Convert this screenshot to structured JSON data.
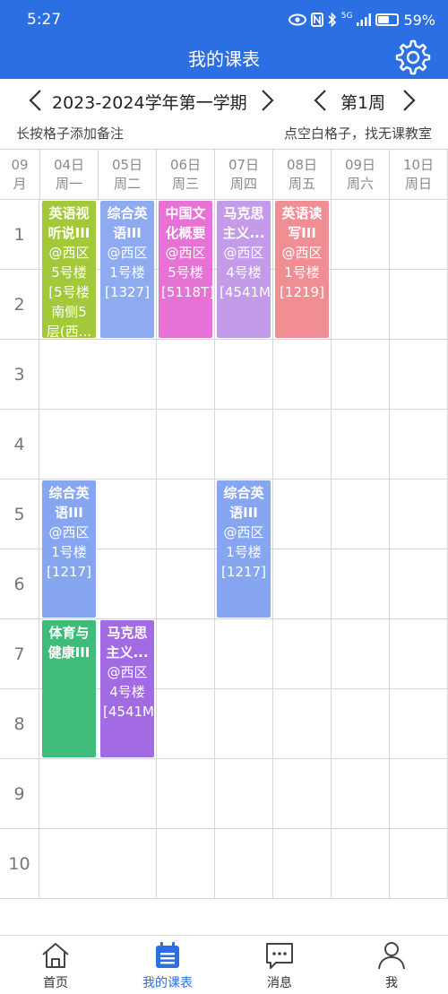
{
  "status_bar": {
    "time": "5:27",
    "network": "5G",
    "battery": "59%"
  },
  "header": {
    "title": "我的课表"
  },
  "nav": {
    "term": "2023-2024学年第一学期",
    "week": "第1周"
  },
  "hints": {
    "left": "长按格子添加备注",
    "right": "点空白格子，找无课教室"
  },
  "month": {
    "value": "09",
    "unit": "月"
  },
  "days": [
    {
      "date": "04日",
      "weekday": "周一"
    },
    {
      "date": "05日",
      "weekday": "周二"
    },
    {
      "date": "06日",
      "weekday": "周三"
    },
    {
      "date": "07日",
      "weekday": "周四"
    },
    {
      "date": "08日",
      "weekday": "周五"
    },
    {
      "date": "09日",
      "weekday": "周六"
    },
    {
      "date": "10日",
      "weekday": "周日"
    }
  ],
  "periods": [
    "1",
    "2",
    "3",
    "4",
    "5",
    "6",
    "7",
    "8",
    "9",
    "10"
  ],
  "courses": [
    {
      "name": "英语视听说III",
      "location": "@西区5号楼[5号楼南侧5层(西...",
      "day": 1,
      "start": 1,
      "end": 2,
      "color": "#a3c93a"
    },
    {
      "name": "综合英语III",
      "location": "@西区1号楼[1327]",
      "day": 2,
      "start": 1,
      "end": 2,
      "color": "#8eaaf0"
    },
    {
      "name": "中国文化概要",
      "location": "@西区5号楼[5118T]",
      "day": 3,
      "start": 1,
      "end": 2,
      "color": "#e572d4"
    },
    {
      "name": "马克思主义...",
      "location": "@西区4号楼[4541M]",
      "day": 4,
      "start": 1,
      "end": 2,
      "color": "#c49be8"
    },
    {
      "name": "英语读写III",
      "location": "@西区1号楼[1219]",
      "day": 5,
      "start": 1,
      "end": 2,
      "color": "#f08e93"
    },
    {
      "name": "综合英语III",
      "location": "@西区1号楼[1217]",
      "day": 1,
      "start": 5,
      "end": 6,
      "color": "#86a6f2"
    },
    {
      "name": "综合英语III",
      "location": "@西区1号楼[1217]",
      "day": 4,
      "start": 5,
      "end": 6,
      "color": "#86a6f2"
    },
    {
      "name": "体育与健康III",
      "location": "",
      "day": 1,
      "start": 7,
      "end": 8,
      "color": "#3ebd7a"
    },
    {
      "name": "马克思主义...",
      "location": "@西区4号楼[4541M]",
      "day": 2,
      "start": 7,
      "end": 8,
      "color": "#a26ae3"
    }
  ],
  "tabs": [
    {
      "label": "首页",
      "icon": "home-icon",
      "active": false
    },
    {
      "label": "我的课表",
      "icon": "schedule-icon",
      "active": true
    },
    {
      "label": "消息",
      "icon": "message-icon",
      "active": false
    },
    {
      "label": "我",
      "icon": "profile-icon",
      "active": false
    }
  ],
  "colors": {
    "accent": "#2b6fe3",
    "grid_line": "#d6d6d6"
  }
}
